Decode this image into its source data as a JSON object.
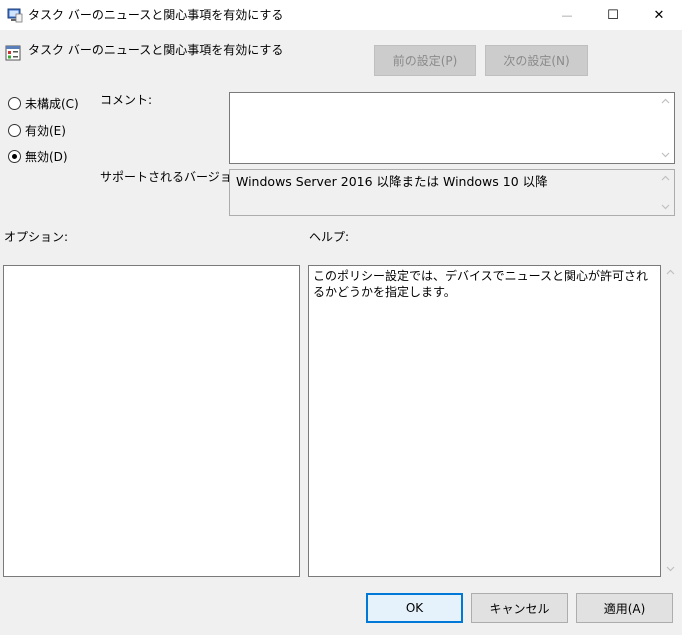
{
  "window": {
    "title": "タスク バーのニュースと関心事項を有効にする",
    "minimize_glyph": "—",
    "maximize_glyph": "☐",
    "close_glyph": "✕"
  },
  "header": {
    "policy_title": "タスク バーのニュースと関心事項を有効にする",
    "prev_label": "前の設定(P)",
    "next_label": "次の設定(N)"
  },
  "state": {
    "options": [
      {
        "label": "未構成(C)",
        "selected": false
      },
      {
        "label": "有効(E)",
        "selected": false
      },
      {
        "label": "無効(D)",
        "selected": true
      }
    ]
  },
  "comment": {
    "label": "コメント:",
    "value": ""
  },
  "supported": {
    "label": "サポートされるバージョン:",
    "value": "Windows Server 2016 以降または Windows 10 以降"
  },
  "options_panel": {
    "label": "オプション:"
  },
  "help_panel": {
    "label": "ヘルプ:",
    "text": "このポリシー設定では、デバイスでニュースと関心が許可されるかどうかを指定します。"
  },
  "footer": {
    "ok_label": "OK",
    "cancel_label": "キャンセル",
    "apply_label": "適用(A)"
  }
}
